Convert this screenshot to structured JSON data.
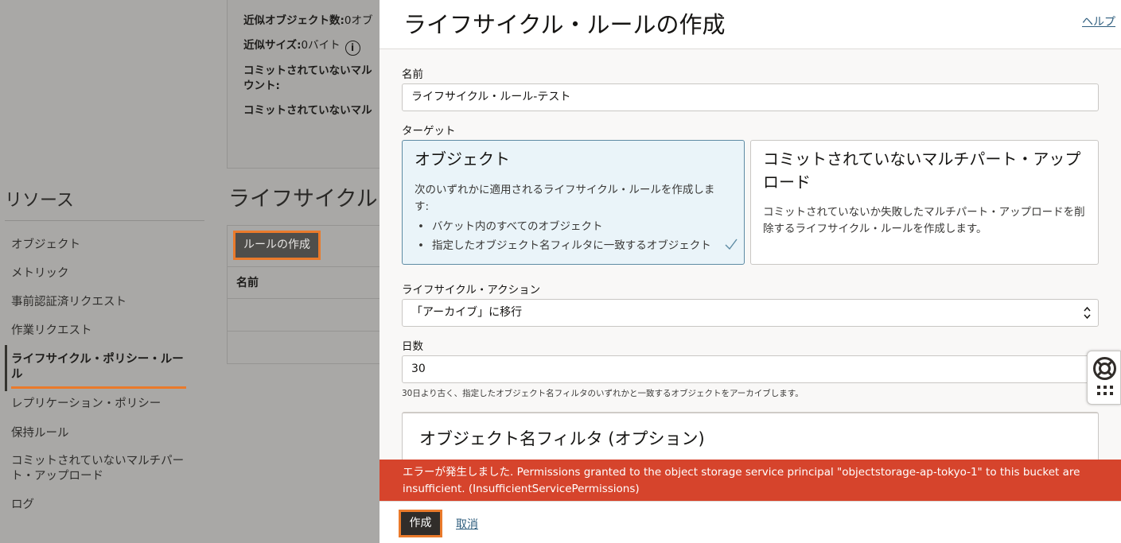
{
  "background": {
    "details": [
      {
        "label": "近似オブジェクト数:",
        "value": "0オブ"
      },
      {
        "label": "近似サイズ:",
        "value": "0バイト"
      },
      {
        "label": "コミットされていないマル",
        "value": ""
      },
      {
        "label": "ウント:",
        "value": ""
      },
      {
        "label": "コミットされていないマル",
        "value": ""
      }
    ],
    "info_icon_glyph": "i",
    "resources": {
      "title": "リソース",
      "items": [
        {
          "label": "オブジェクト"
        },
        {
          "label": "メトリック"
        },
        {
          "label": "事前認証済リクエスト"
        },
        {
          "label": "作業リクエスト"
        },
        {
          "label": "ライフサイクル・ポリシー・ルール"
        },
        {
          "label": "レプリケーション・ポリシー"
        },
        {
          "label": "保持ルール"
        },
        {
          "label": "コミットされていないマルチパート・アップロード"
        },
        {
          "label": "ログ"
        }
      ]
    },
    "lifecycle_title": "ライフサイクル",
    "create_rule_button": "ルールの作成",
    "table_header_name": "名前"
  },
  "drawer": {
    "title": "ライフサイクル・ルールの作成",
    "help_link": "ヘルプ",
    "name_label": "名前",
    "name_value": "ライフサイクル・ルール-テスト",
    "target_label": "ターゲット",
    "target_cards": [
      {
        "title": "オブジェクト",
        "description": "次のいずれかに適用されるライフサイクル・ルールを作成します:",
        "bullets": [
          "バケット内のすべてのオブジェクト",
          "指定したオブジェクト名フィルタに一致するオブジェクト"
        ],
        "selected": true
      },
      {
        "title": "コミットされていないマルチパート・アップロード",
        "description": "コミットされていないか失敗したマルチパート・アップロードを削除するライフサイクル・ルールを作成します。",
        "selected": false
      }
    ],
    "action_label": "ライフサイクル・アクション",
    "action_value": "「アーカイブ」に移行",
    "days_label": "日数",
    "days_value": "30",
    "days_hint": "30日より古く、指定したオブジェクト名フィルタのいずれかと一致するオブジェクトをアーカイブします。",
    "filter_title": "オブジェクト名フィルタ (オプション)",
    "error_message": "エラーが発生しました. Permissions granted to the object storage service principal \"objectstorage-ap-tokyo-1\" to this bucket are insufficient. (InsufficientServicePermissions)",
    "create_button": "作成",
    "cancel_link": "取消"
  },
  "colors": {
    "accent_highlight": "#ea7a2b",
    "error_bar": "#d6442c",
    "selected_card": "#eaf4f9",
    "link": "#2f5e7e",
    "primary_button": "#312d2a"
  },
  "icons": [
    "info-icon",
    "checkmark-icon",
    "select-arrows-icon",
    "lifebuoy-icon",
    "grid-dots-icon"
  ]
}
